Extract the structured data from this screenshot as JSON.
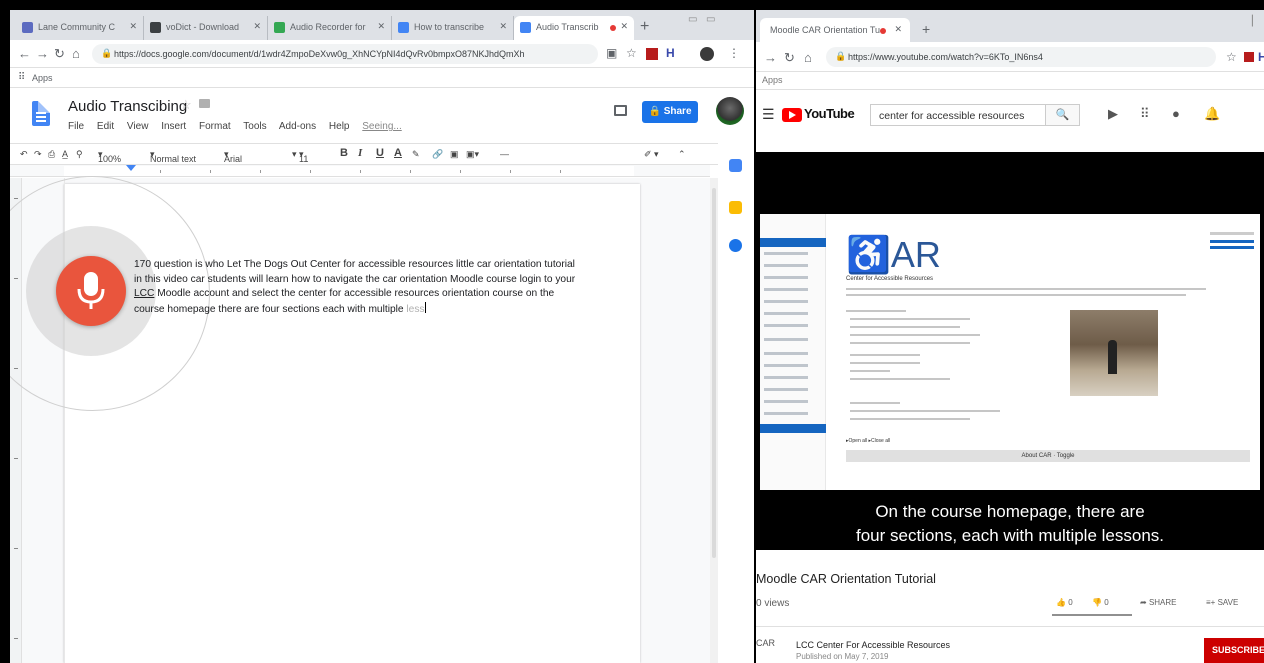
{
  "left_browser": {
    "tabs": [
      {
        "label": "Lane Community C",
        "favicon_color": "#5c6bc0"
      },
      {
        "label": "voDict - Download",
        "favicon_color": "#3c4043"
      },
      {
        "label": "Audio Recorder for",
        "favicon_color": "#34a853"
      },
      {
        "label": "How to transcribe",
        "favicon_color": "#4285f4"
      },
      {
        "label": "Audio Transcrib",
        "favicon_color": "#4285f4"
      }
    ],
    "new_tab": "+",
    "url": "https://docs.google.com/document/d/1wdr4ZmpoDeXvw0g_XhNCYpNI4dQvRv0bmpxO87NKJhdQmXh",
    "bookmarks_apps": "Apps",
    "accent": "#1a73e8"
  },
  "doc": {
    "title": "Audio Transcibing",
    "menu": [
      "File",
      "Edit",
      "View",
      "Insert",
      "Format",
      "Tools",
      "Add-ons",
      "Help"
    ],
    "last_edit": "Seeing...",
    "share_label": "Share",
    "toolbar": {
      "zoom": "100%",
      "style": "Normal text",
      "font": "Arial",
      "size": "11",
      "bold": "B",
      "italic": "I",
      "underline": "U",
      "color": "A"
    },
    "body": {
      "p1": "170 question is who Let The Dogs Out Center for accessible resources little car orientation tutorial in this video car students will learn how to navigate the car orientation Moodle course ",
      "p2": "login to your ",
      "p2_link": "LCC",
      "p3": " Moodle account and select the center for accessible resources orientation course on the course homepage there are four sections each with multiple ",
      "pending": "less"
    },
    "mic_color": "#e9553d"
  },
  "right_browser": {
    "tab_label": "Moodle CAR Orientation Tu",
    "new_tab": "+",
    "url": "https://www.youtube.com/watch?v=6KTo_IN6ns4",
    "bookmarks_apps": "Apps"
  },
  "youtube": {
    "logo_text": "YouTube",
    "search_value": "center for accessible resources",
    "video": {
      "caption_line1": "On the course homepage, there are",
      "caption_line2": "four sections, each with multiple lessons.",
      "screen_logo": "♿AR",
      "screen_title": "Center for Accessible Resources",
      "screen_section": "About CAR",
      "screen_toggle": "Toggle",
      "screen_open_all": "Open all",
      "screen_close_all": "Close all"
    },
    "title": "Moodle CAR Orientation Tutorial",
    "views": "0 views",
    "likes": "0",
    "dislikes": "0",
    "share": "SHARE",
    "save": "SAVE",
    "channel_avatar": "CAR",
    "channel_name": "LCC Center For Accessible Resources",
    "published": "Published on May 7, 2019",
    "subscribe": "SUBSCRIBE",
    "subscribe_color": "#cc0000"
  }
}
